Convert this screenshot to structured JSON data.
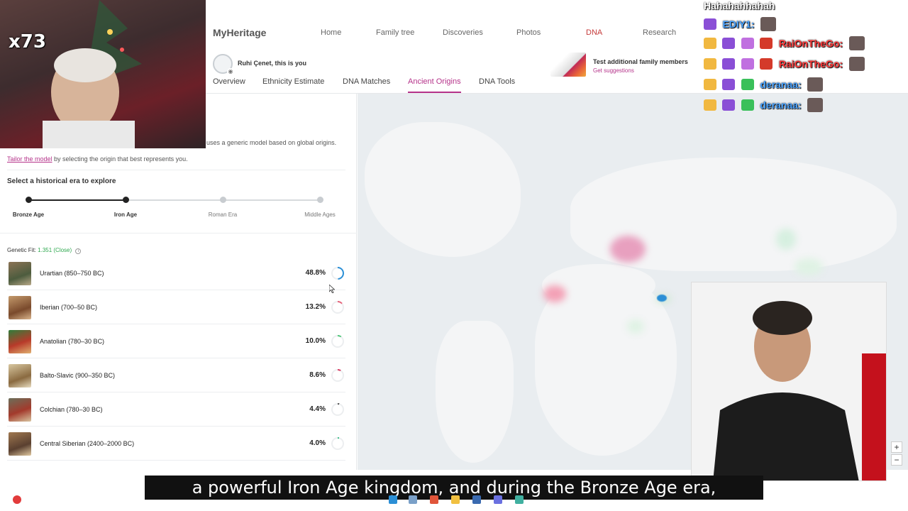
{
  "nav": {
    "logo": "MyHeritage",
    "links": [
      "Home",
      "Family tree",
      "Discoveries",
      "Photos",
      "DNA",
      "Research"
    ]
  },
  "profile": {
    "name": "Ruhi Çenet, this is you"
  },
  "promo": {
    "title": "Test additional family members",
    "link": "Get suggestions"
  },
  "tabs": [
    {
      "label": "Overview",
      "active": false
    },
    {
      "label": "Ethnicity Estimate",
      "active": false
    },
    {
      "label": "DNA Matches",
      "active": false
    },
    {
      "label": "Ancient Origins",
      "active": true
    },
    {
      "label": "DNA Tools",
      "active": false
    }
  ],
  "panel": {
    "model_note": "uses a generic model based on global origins.",
    "tailor_link": "Tailor the model",
    "tailor_rest": " by selecting the origin that best represents you.",
    "era_title": "Select a historical era to explore",
    "eras": [
      "Bronze Age",
      "Iron Age",
      "Roman Era",
      "Middle Ages"
    ],
    "selected_era": "Iron Age",
    "genetic_fit_label": "Genetic Fit:",
    "genetic_fit_value": "1.351 (Close)",
    "origins": [
      {
        "name": "Urartian (850–750 BC)",
        "percent": "48.8%",
        "fraction": 0.488,
        "color": "#2b8fd6"
      },
      {
        "name": "Iberian (700–50 BC)",
        "percent": "13.2%",
        "fraction": 0.132,
        "color": "#e5677d"
      },
      {
        "name": "Anatolian (780–30 BC)",
        "percent": "10.0%",
        "fraction": 0.1,
        "color": "#55c77e"
      },
      {
        "name": "Balto-Slavic (900–350 BC)",
        "percent": "8.6%",
        "fraction": 0.086,
        "color": "#d94469"
      },
      {
        "name": "Colchian (780–30 BC)",
        "percent": "4.4%",
        "fraction": 0.044,
        "color": "#555555"
      },
      {
        "name": "Central Siberian (2400–2000 BC)",
        "percent": "4.0%",
        "fraction": 0.04,
        "color": "#3fbf8a"
      }
    ]
  },
  "map": {
    "zoom_in": "+",
    "zoom_out": "−"
  },
  "stream": {
    "multiplier": "x73",
    "chat_header": "Hahahahhahah",
    "chat": [
      {
        "user": "EDIY1:",
        "color": "#4aa3ff"
      },
      {
        "user": "RaiOnTheGo:",
        "color": "#ff3b3b"
      },
      {
        "user": "RaiOnTheGo:",
        "color": "#ff3b3b"
      },
      {
        "user": "deranaa:",
        "color": "#4aa3ff"
      },
      {
        "user": "deranaa:",
        "color": "#4aa3ff"
      }
    ],
    "subtitle": "a powerful Iron Age kingdom, and during the Bronze Age era,"
  }
}
